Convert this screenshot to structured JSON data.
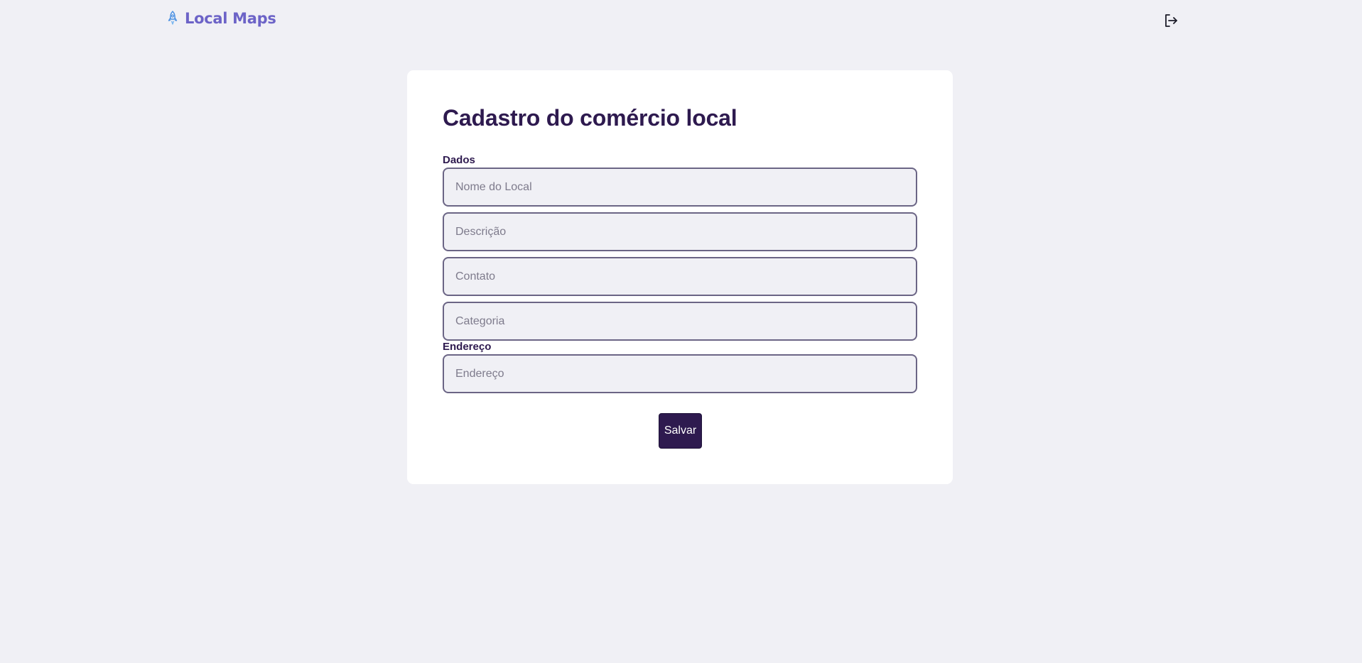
{
  "header": {
    "brand_name": "Local Maps",
    "brand_icon": "rocket-icon",
    "logout_icon": "logout-icon",
    "brand_color": "#6c63c7"
  },
  "form": {
    "title": "Cadastro do comércio local",
    "sections": {
      "dados_label": "Dados",
      "endereco_label": "Endereço"
    },
    "fields": {
      "nome": {
        "placeholder": "Nome do Local",
        "value": ""
      },
      "descricao": {
        "placeholder": "Descrição",
        "value": ""
      },
      "contato": {
        "placeholder": "Contato",
        "value": ""
      },
      "categoria": {
        "placeholder": "Categoria",
        "value": ""
      },
      "endereco": {
        "placeholder": "Endereço",
        "value": ""
      }
    },
    "save_label": "Salvar"
  },
  "colors": {
    "background": "#f0f0f5",
    "card": "#ffffff",
    "primary": "#2e1a4f",
    "field_border": "#6b6585"
  }
}
